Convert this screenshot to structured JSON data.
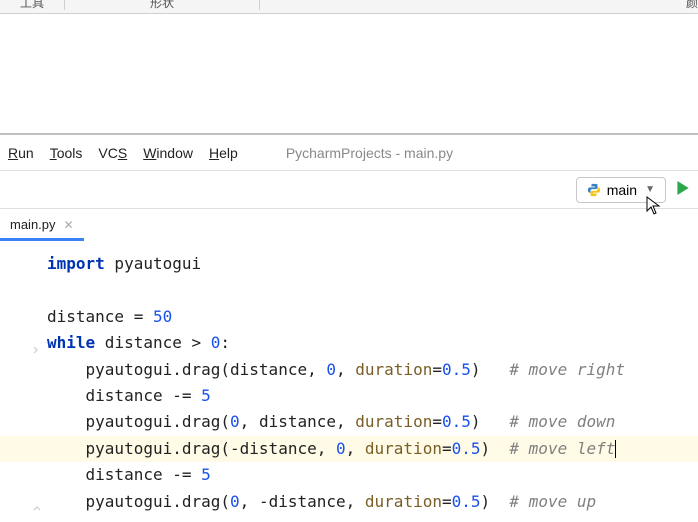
{
  "topToolbar": {
    "label1": "工具",
    "label2": "形状",
    "label3": "颜"
  },
  "menu": {
    "run": "Run",
    "tools": "Tools",
    "vcs": "VCS",
    "window": "Window",
    "help": "Help"
  },
  "projectTitle": "PycharmProjects - main.py",
  "runConfig": {
    "label": "main"
  },
  "tab": {
    "label": "main.py"
  },
  "code": {
    "l1_kw": "import",
    "l1_rest": " pyautogui",
    "l3_a": "distance = ",
    "l3_num": "50",
    "l4_kw": "while",
    "l4_a": " distance > ",
    "l4_num": "0",
    "l4_b": ":",
    "l5_a": "    pyautogui.drag(distance, ",
    "l5_num": "0",
    "l5_b": ", ",
    "l5_param": "duration",
    "l5_c": "=",
    "l5_num2": "0.5",
    "l5_d": ")   ",
    "l5_comment": "# move right",
    "l6_a": "    distance -= ",
    "l6_num": "5",
    "l7_a": "    pyautogui.drag(",
    "l7_num": "0",
    "l7_b": ", distance, ",
    "l7_param": "duration",
    "l7_c": "=",
    "l7_num2": "0.5",
    "l7_d": ")   ",
    "l7_comment": "# move down",
    "l8_a": "    pyautogui.drag(-distance, ",
    "l8_num": "0",
    "l8_b": ", ",
    "l8_param": "duration",
    "l8_c": "=",
    "l8_num2": "0.5",
    "l8_d": ")  ",
    "l8_comment": "# move left",
    "l9_a": "    distance -= ",
    "l9_num": "5",
    "l10_a": "    pyautogui.drag(",
    "l10_num": "0",
    "l10_b": ", -distance, ",
    "l10_param": "duration",
    "l10_c": "=",
    "l10_num2": "0.5",
    "l10_d": ")  ",
    "l10_comment": "# move up"
  }
}
